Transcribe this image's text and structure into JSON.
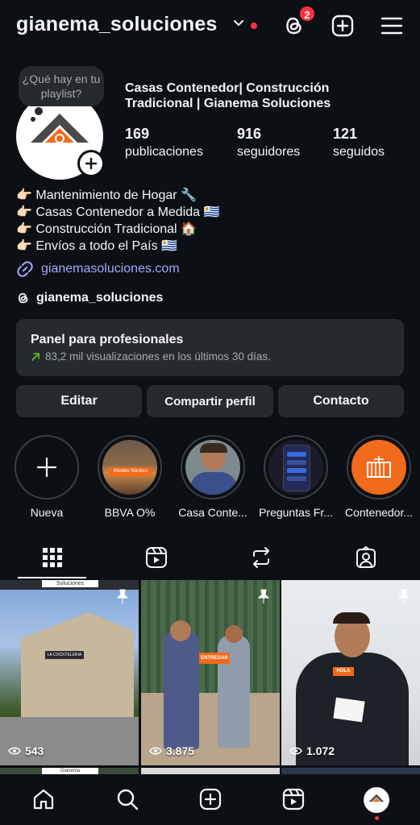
{
  "header": {
    "username": "gianema_soluciones",
    "notification_count": "2",
    "icons": [
      "chevron-down-icon",
      "threads-icon",
      "create-icon",
      "menu-icon"
    ]
  },
  "profile": {
    "note": "¿Qué hay en tu playlist?",
    "full_name": "Casas Contenedor| Construcción Tradicional | Gianema Soluciones",
    "stats": [
      {
        "value": "169",
        "label": "publicaciones"
      },
      {
        "value": "916",
        "label": "seguidores"
      },
      {
        "value": "121",
        "label": "seguidos"
      }
    ],
    "bio": [
      "👉🏻 Mantenimiento de Hogar 🔧",
      "👉🏻 Casas Contenedor a Medida 🇺🇾",
      "👉🏻 Construcción Tradicional 🏠",
      "👉🏻 Envíos a todo el País 🇺🇾"
    ],
    "link": "gianemasoluciones.com",
    "threads_handle": "gianema_soluciones"
  },
  "panel": {
    "title": "Panel para profesionales",
    "subtitle": "83,2 mil visualizaciones en los últimos 30 días."
  },
  "buttons": {
    "edit": "Editar",
    "share": "Compartir perfil",
    "contact": "Contacto"
  },
  "highlights": [
    {
      "label": "Nueva"
    },
    {
      "label": "BBVA O%"
    },
    {
      "label": "Casa Conte..."
    },
    {
      "label": "Preguntas Fr..."
    },
    {
      "label": "Contenedor..."
    }
  ],
  "grid": [
    {
      "views": "543",
      "overlay_text": "Soluciones",
      "sign": "LA COCKTELERIA"
    },
    {
      "views": "3.875",
      "sign": "ENTREGAR"
    },
    {
      "views": "1.072",
      "sign": "HOLA"
    }
  ],
  "grid_peek_text": "Gianema",
  "highlight_sign": "Modelo Nórdico",
  "colors": {
    "background": "#0c1014",
    "surface": "#262a2f",
    "accent_red": "#ff3040",
    "link": "#a0a8ff",
    "brand_orange": "#f26a1b"
  }
}
